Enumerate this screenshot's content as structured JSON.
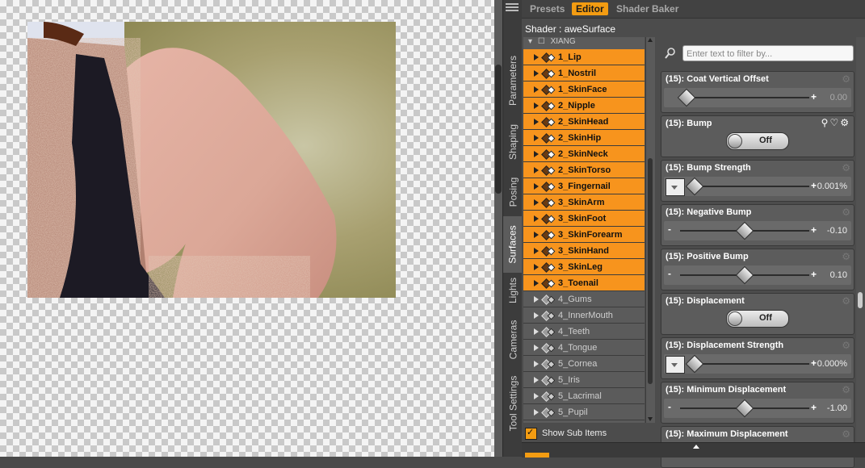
{
  "top_tabs": [
    {
      "label": "Presets",
      "active": false
    },
    {
      "label": "Editor",
      "active": true
    },
    {
      "label": "Shader Baker",
      "active": false
    }
  ],
  "shader_label": "Shader : aweSurface",
  "side_tabs": [
    {
      "label": "Parameters",
      "active": false
    },
    {
      "label": "Shaping",
      "active": false
    },
    {
      "label": "Posing",
      "active": false
    },
    {
      "label": "Surfaces",
      "active": true
    },
    {
      "label": "Lights",
      "active": false
    },
    {
      "label": "Cameras",
      "active": false
    },
    {
      "label": "Tool Settings",
      "active": false
    }
  ],
  "surface_list": {
    "header": "XIANG",
    "items": [
      {
        "label": "1_Lip",
        "selected": true
      },
      {
        "label": "1_Nostril",
        "selected": true
      },
      {
        "label": "1_SkinFace",
        "selected": true
      },
      {
        "label": "2_Nipple",
        "selected": true
      },
      {
        "label": "2_SkinHead",
        "selected": true
      },
      {
        "label": "2_SkinHip",
        "selected": true
      },
      {
        "label": "2_SkinNeck",
        "selected": true
      },
      {
        "label": "2_SkinTorso",
        "selected": true
      },
      {
        "label": "3_Fingernail",
        "selected": true
      },
      {
        "label": "3_SkinArm",
        "selected": true
      },
      {
        "label": "3_SkinFoot",
        "selected": true
      },
      {
        "label": "3_SkinForearm",
        "selected": true
      },
      {
        "label": "3_SkinHand",
        "selected": true
      },
      {
        "label": "3_SkinLeg",
        "selected": true
      },
      {
        "label": "3_Toenail",
        "selected": true
      },
      {
        "label": "4_Gums",
        "selected": false
      },
      {
        "label": "4_InnerMouth",
        "selected": false
      },
      {
        "label": "4_Teeth",
        "selected": false
      },
      {
        "label": "4_Tongue",
        "selected": false
      },
      {
        "label": "5_Cornea",
        "selected": false
      },
      {
        "label": "5_Iris",
        "selected": false
      },
      {
        "label": "5_Lacrimal",
        "selected": false
      },
      {
        "label": "5_Pupil",
        "selected": false
      }
    ],
    "show_sub_items_label": "Show Sub Items",
    "show_sub_items_checked": true
  },
  "filter": {
    "placeholder": "Enter text to filter by..."
  },
  "properties": [
    {
      "title": "(15): Coat Vertical Offset",
      "kind": "slider",
      "value": "0.00",
      "level": 0.0,
      "minus": false,
      "swatch": false,
      "dim": true
    },
    {
      "title": "(15): Bump",
      "kind": "toggle",
      "value": "Off"
    },
    {
      "title": "(15): Bump Strength",
      "kind": "slider",
      "value": "0.001%",
      "level": 0.0,
      "minus": false,
      "swatch": true,
      "dim": false
    },
    {
      "title": "(15): Negative Bump",
      "kind": "slider",
      "value": "-0.10",
      "level": 0.45,
      "minus": true,
      "swatch": false,
      "dim": false
    },
    {
      "title": "(15): Positive Bump",
      "kind": "slider",
      "value": "0.10",
      "level": 0.45,
      "minus": true,
      "swatch": false,
      "dim": false
    },
    {
      "title": "(15): Displacement",
      "kind": "toggle",
      "value": "Off"
    },
    {
      "title": "(15): Displacement Strength",
      "kind": "slider",
      "value": "0.000%",
      "level": 0.0,
      "minus": false,
      "swatch": true,
      "dim": false
    },
    {
      "title": "(15): Minimum Displacement",
      "kind": "slider",
      "value": "-1.00",
      "level": 0.45,
      "minus": true,
      "swatch": false,
      "dim": false
    },
    {
      "title": "(15): Maximum Displacement",
      "kind": "header-only"
    }
  ],
  "colors": {
    "accent": "#f39c12",
    "panel": "#4c4c4c",
    "selected_row": "#f7941d"
  }
}
